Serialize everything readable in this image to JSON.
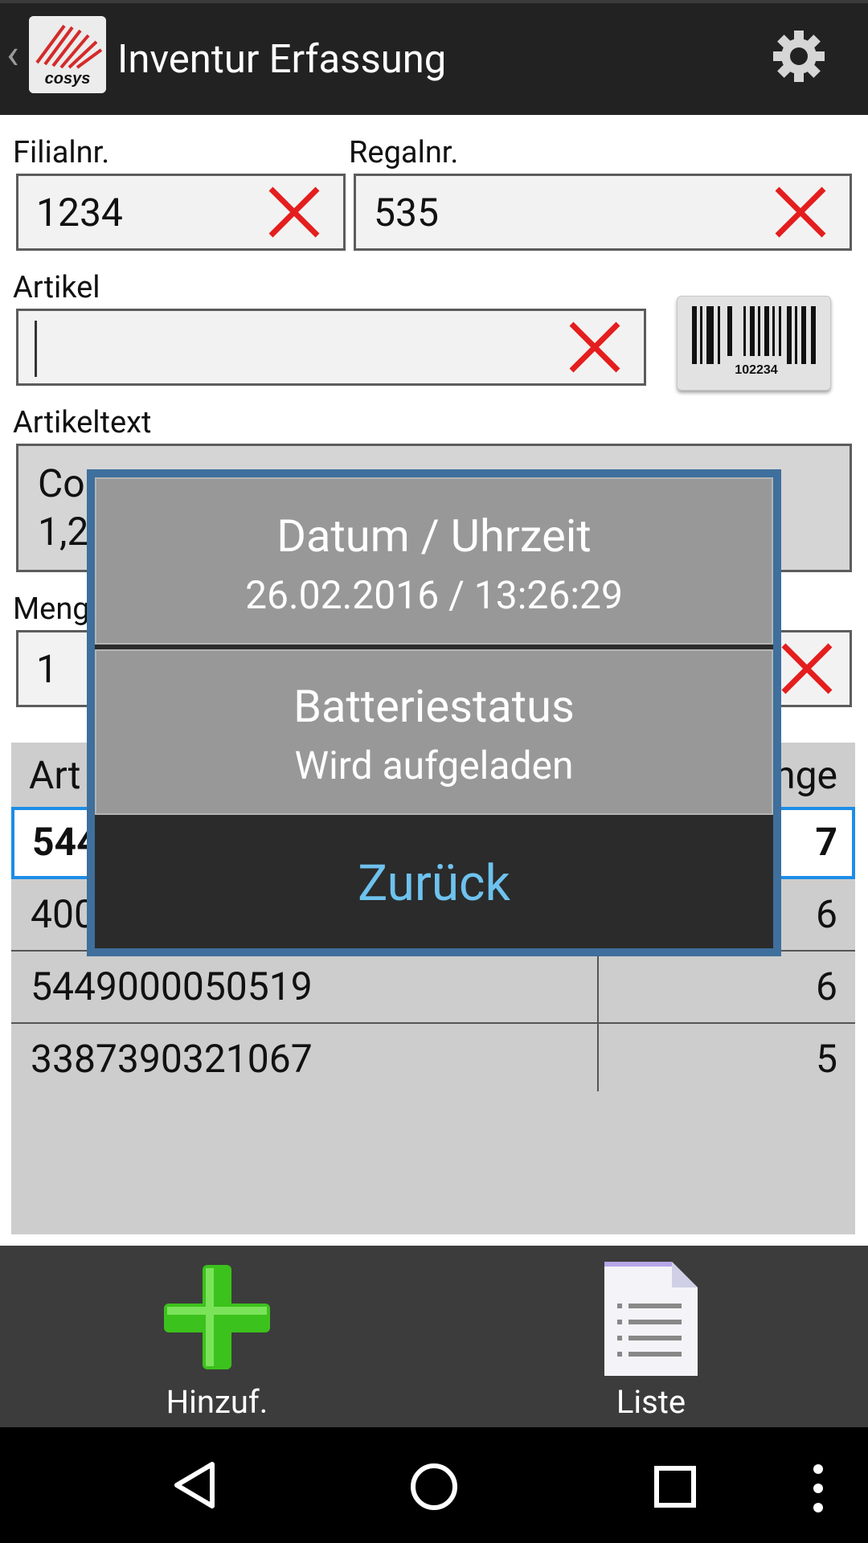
{
  "app": {
    "title": "Inventur Erfassung",
    "logo_text": "cosys"
  },
  "form": {
    "branch": {
      "label": "Filialnr.",
      "value": "1234"
    },
    "shelf": {
      "label": "Regalnr.",
      "value": "535"
    },
    "article": {
      "label": "Artikel",
      "value": ""
    },
    "article_text": {
      "label": "Artikeltext",
      "line1": "Co",
      "line2": "1,2"
    },
    "quantity": {
      "label": "Meng",
      "value": "1"
    },
    "barcode_number": "102234"
  },
  "table": {
    "header_left": "Art",
    "header_right": "nge",
    "rows": [
      {
        "article": "544",
        "qty": "7",
        "selected": true
      },
      {
        "article": "400",
        "qty": "6"
      },
      {
        "article": "5449000050519",
        "qty": "6"
      },
      {
        "article": "3387390321067",
        "qty": "5"
      }
    ]
  },
  "dialog": {
    "datetime_title": "Datum / Uhrzeit",
    "datetime_value": "26.02.2016 / 13:26:29",
    "battery_title": "Batteriestatus",
    "battery_value": "Wird aufgeladen",
    "back_label": "Zurück"
  },
  "toolbar": {
    "add_label": "Hinzuf.",
    "list_label": "Liste"
  },
  "colors": {
    "accent": "#1d8de6",
    "dialog_border": "#3f6f9c",
    "back_text": "#6ec2ee",
    "clear_red": "#e41e1e",
    "add_green": "#3cc21c"
  }
}
